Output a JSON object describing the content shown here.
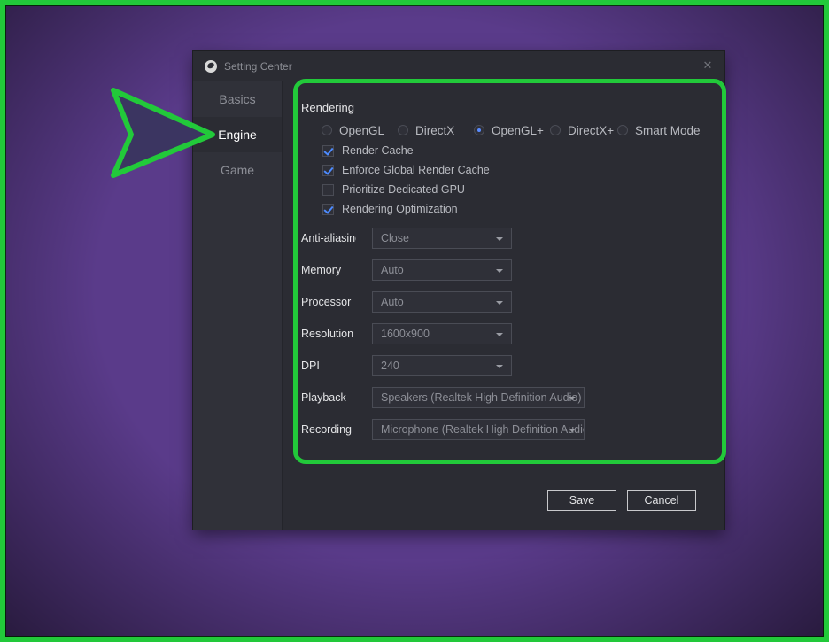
{
  "window": {
    "title": "Setting Center",
    "minimize_icon": "minimize-icon",
    "close_icon": "close-icon"
  },
  "sidebar": {
    "items": [
      {
        "label": "Basics",
        "active": false
      },
      {
        "label": "Engine",
        "active": true
      },
      {
        "label": "Game",
        "active": false
      }
    ]
  },
  "rendering": {
    "title": "Rendering",
    "modes": [
      {
        "label": "OpenGL",
        "selected": false
      },
      {
        "label": "DirectX",
        "selected": false
      },
      {
        "label": "OpenGL+",
        "selected": true
      },
      {
        "label": "DirectX+",
        "selected": false
      },
      {
        "label": "Smart Mode",
        "selected": false
      }
    ],
    "options": [
      {
        "label": "Render Cache",
        "checked": true
      },
      {
        "label": "Enforce Global Render Cache",
        "checked": true
      },
      {
        "label": "Prioritize Dedicated GPU",
        "checked": false
      },
      {
        "label": "Rendering Optimization",
        "checked": true
      }
    ]
  },
  "settings": [
    {
      "label": "Anti-aliasing",
      "value": "Close"
    },
    {
      "label": "Memory",
      "value": "Auto"
    },
    {
      "label": "Processor",
      "value": "Auto"
    },
    {
      "label": "Resolution",
      "value": "1600x900"
    },
    {
      "label": "DPI",
      "value": "240"
    },
    {
      "label": "Playback",
      "value": "Speakers (Realtek High Definition Audio)"
    },
    {
      "label": "Recording",
      "value": "Microphone (Realtek High Definition Audio)"
    }
  ],
  "buttons": {
    "save": "Save",
    "cancel": "Cancel"
  },
  "colors": {
    "highlight": "#22c93a",
    "background": "#5a3b8a",
    "accent": "#4d8bff"
  }
}
